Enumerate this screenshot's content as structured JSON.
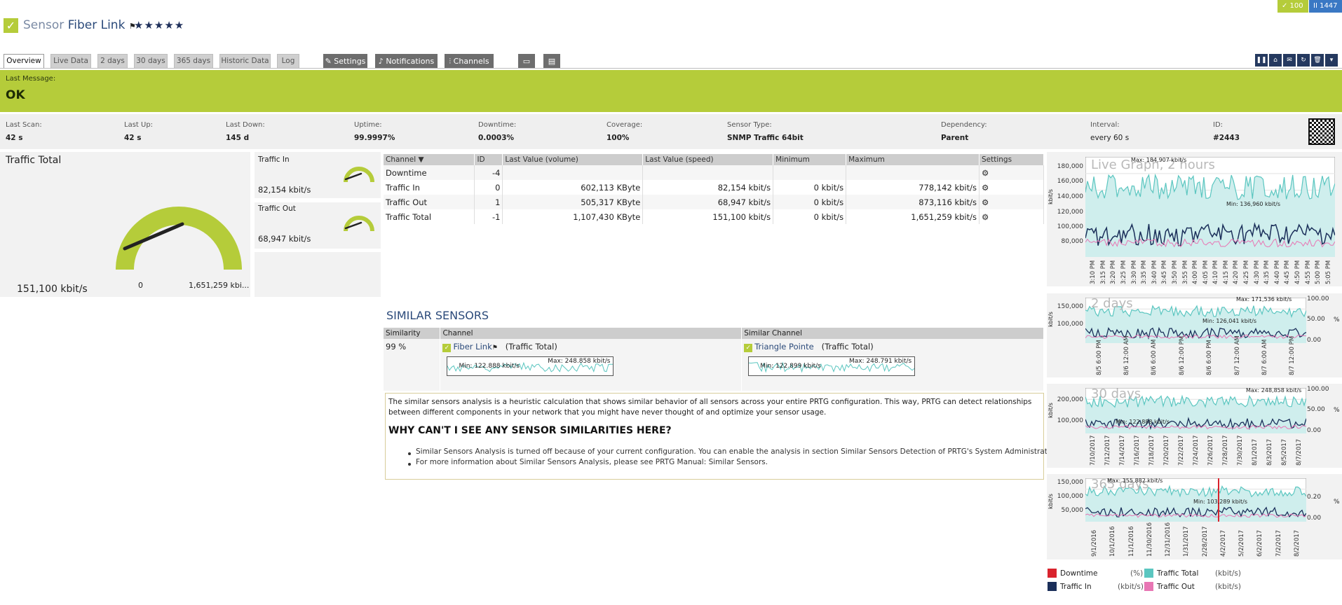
{
  "header": {
    "title_prefix": "Sensor",
    "title_name": "Fiber Link",
    "flag": "⚑",
    "stars": "★★★★★",
    "badge_ok": "✓ 100",
    "badge_pause": "II 1447"
  },
  "tabs": [
    "Overview",
    "Live Data",
    "2 days",
    "30 days",
    "365 days",
    "Historic Data",
    "Log"
  ],
  "buttons": {
    "settings": "Settings",
    "notifications": "Notifications",
    "channels": "Channels"
  },
  "last_message": {
    "label": "Last Message:",
    "value": "OK"
  },
  "info": [
    {
      "label": "Last Scan:",
      "value": "42 s"
    },
    {
      "label": "Last Up:",
      "value": "42 s"
    },
    {
      "label": "Last Down:",
      "value": "145 d"
    },
    {
      "label": "Uptime:",
      "value": "99.9997%"
    },
    {
      "label": "Downtime:",
      "value": "0.0003%"
    },
    {
      "label": "Coverage:",
      "value": "100%"
    },
    {
      "label": "Sensor Type:",
      "value": "SNMP Traffic 64bit"
    },
    {
      "label": "Dependency:",
      "value": "Parent"
    },
    {
      "label": "Interval:",
      "value": "every 60 s"
    },
    {
      "label": "ID:",
      "value": "#2443"
    }
  ],
  "gauges": {
    "total": {
      "title": "Traffic Total",
      "value": "151,100 kbit/s",
      "min": "0",
      "max": "1,651,259 kbi...",
      "fraction": 0.0915
    },
    "in": {
      "title": "Traffic In",
      "value": "82,154 kbit/s"
    },
    "out": {
      "title": "Traffic Out",
      "value": "68,947 kbit/s"
    }
  },
  "channel_table": {
    "headers": [
      "Channel ▼",
      "ID",
      "Last Value (volume)",
      "Last Value (speed)",
      "Minimum",
      "Maximum",
      "Settings"
    ],
    "rows": [
      [
        "Downtime",
        "-4",
        "",
        "",
        "",
        "",
        "⚙"
      ],
      [
        "Traffic In",
        "0",
        "602,113 KByte",
        "82,154 kbit/s",
        "0 kbit/s",
        "778,142 kbit/s",
        "⚙"
      ],
      [
        "Traffic Out",
        "1",
        "505,317 KByte",
        "68,947 kbit/s",
        "0 kbit/s",
        "873,116 kbit/s",
        "⚙"
      ],
      [
        "Traffic Total",
        "-1",
        "1,107,430 KByte",
        "151,100 kbit/s",
        "0 kbit/s",
        "1,651,259 kbit/s",
        "⚙"
      ]
    ]
  },
  "similar": {
    "title": "SIMILAR SENSORS",
    "headers": [
      "Similarity",
      "Channel",
      "Similar Channel"
    ],
    "row": {
      "similarity": "99 %",
      "channel_name": "Fiber Link",
      "channel_sub": "(Traffic Total)",
      "channel_min": "Min: 122.888 kbit/s",
      "channel_max": "Max: 248.858 kbit/s",
      "similar_name": "Triangle Pointe",
      "similar_sub": "(Traffic Total)",
      "similar_min": "Min: 122.899 kbit/s",
      "similar_max": "Max: 248.791 kbit/s"
    }
  },
  "explain": {
    "text": "The similar sensors analysis is a heuristic calculation that shows similar behavior of all sensors across your entire PRTG configuration. This way, PRTG can detect relationships between different components in your network that you might have never thought of and optimize your sensor usage.",
    "heading": "WHY CAN'T I SEE ANY SENSOR SIMILARITIES HERE?",
    "bullets": [
      "Similar Sensors Analysis is turned off because of your current configuration. You can enable the analysis in section Similar Sensors Detection of PRTG's System Administration",
      "For more information about Similar Sensors Analysis, please see PRTG Manual: Similar Sensors."
    ]
  },
  "graphs": {
    "live": {
      "title": "Live Graph, 2 hours",
      "yunit": "kbit/s",
      "yticks": [
        "180,000",
        "160,000",
        "140,000",
        "120,000",
        "100,000",
        "80,000"
      ],
      "max": "Max: 184,907 kbit/s",
      "min": "Min: 136,960 kbit/s",
      "xticks": [
        "3:10 PM",
        "3:15 PM",
        "3:20 PM",
        "3:25 PM",
        "3:30 PM",
        "3:35 PM",
        "3:40 PM",
        "3:45 PM",
        "3:50 PM",
        "3:55 PM",
        "4:00 PM",
        "4:05 PM",
        "4:10 PM",
        "4:15 PM",
        "4:20 PM",
        "4:25 PM",
        "4:30 PM",
        "4:35 PM",
        "4:40 PM",
        "4:45 PM",
        "4:50 PM",
        "4:55 PM",
        "5:00 PM",
        "5:05 PM"
      ]
    },
    "d2": {
      "title": "2 days",
      "yunit": "kbit/s",
      "yticks": [
        "150,000",
        "100,000"
      ],
      "yticks_r": [
        "100.00",
        "50.00",
        "0.00"
      ],
      "runit": "%",
      "max": "Max: 171,536 kbit/s",
      "min": "Min: 126,041 kbit/s",
      "xticks": [
        "8/5 6:00 PM",
        "8/6 12:00 AM",
        "8/6 6:00 AM",
        "8/6 12:00 PM",
        "8/6 6:00 PM",
        "8/7 12:00 AM",
        "8/7 6:00 AM",
        "8/7 12:00 PM"
      ]
    },
    "d30": {
      "title": "30 days",
      "yunit": "kbit/s",
      "yticks": [
        "200,000",
        "100,000"
      ],
      "yticks_r": [
        "100.00",
        "50.00",
        "0.00"
      ],
      "runit": "%",
      "max": "Max: 248,858 kbit/s",
      "min": "Min: 122,888 kbit/s",
      "xticks": [
        "7/10/2017",
        "7/12/2017",
        "7/14/2017",
        "7/16/2017",
        "7/18/2017",
        "7/20/2017",
        "7/22/2017",
        "7/24/2017",
        "7/26/2017",
        "7/28/2017",
        "7/30/2017",
        "8/1/2017",
        "8/3/2017",
        "8/5/2017",
        "8/7/2017"
      ]
    },
    "d365": {
      "title": "365 days",
      "yunit": "kbit/s",
      "yticks": [
        "150,000",
        "100,000",
        "50,000"
      ],
      "yticks_r": [
        "0.20",
        "0.00"
      ],
      "runit": "%",
      "max": "Max: 155,882 kbit/s",
      "min": "Min: 103,289 kbit/s",
      "xticks": [
        "9/1/2016",
        "10/1/2016",
        "11/1/2016",
        "11/30/2016",
        "12/31/2016",
        "1/31/2017",
        "2/28/2017",
        "4/2/2017",
        "5/2/2017",
        "6/2/2017",
        "7/2/2017",
        "8/2/2017"
      ]
    }
  },
  "legend": [
    {
      "name": "Downtime",
      "unit": "(%)",
      "color": "#d9232d"
    },
    {
      "name": "Traffic Total",
      "unit": "(kbit/s)",
      "color": "#5bc6c0"
    },
    {
      "name": "Traffic In",
      "unit": "(kbit/s)",
      "color": "#1b2f5a"
    },
    {
      "name": "Traffic Out",
      "unit": "(kbit/s)",
      "color": "#e876b4"
    }
  ],
  "colors": {
    "accent": "#b5cc3a",
    "navy": "#1b2f5a",
    "teal": "#5bc6c0",
    "pink": "#e876b4",
    "red": "#d9232d"
  }
}
